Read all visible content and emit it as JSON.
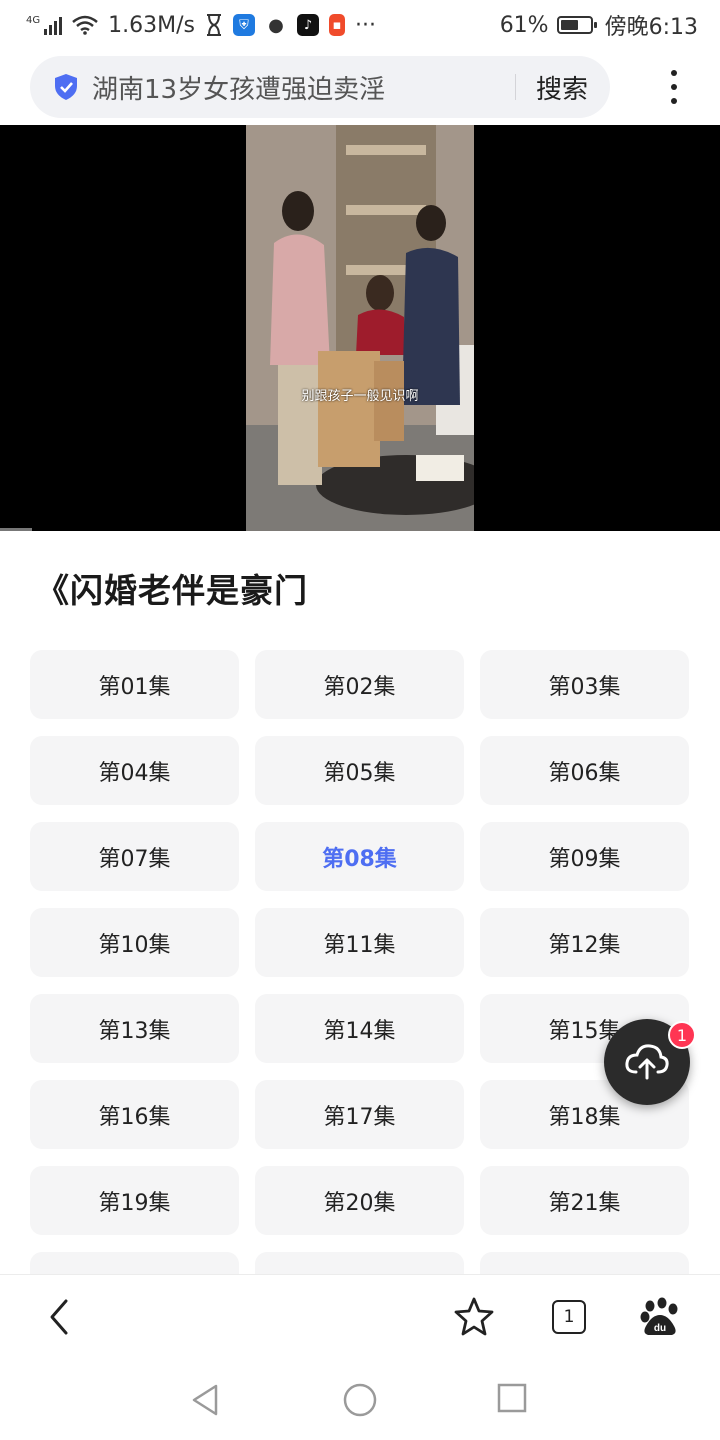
{
  "status_bar": {
    "network": "4G",
    "speed": "1.63M/s",
    "more": "···",
    "battery": "61%",
    "battery_level": 0.61,
    "time": "傍晚6:13"
  },
  "search": {
    "query": "湖南13岁女孩遭强迫卖淫",
    "button_label": "搜索"
  },
  "video": {
    "subtitle": "别跟孩子一般见识啊"
  },
  "drama": {
    "title": "《闪婚老伴是豪门"
  },
  "episodes": [
    "第01集",
    "第02集",
    "第03集",
    "第04集",
    "第05集",
    "第06集",
    "第07集",
    "第08集",
    "第09集",
    "第10集",
    "第11集",
    "第12集",
    "第13集",
    "第14集",
    "第15集",
    "第16集",
    "第17集",
    "第18集",
    "第19集",
    "第20集",
    "第21集",
    "",
    "",
    ""
  ],
  "active_episode": "第08集",
  "fab": {
    "icon": "cloud-upload-icon",
    "badge": "1"
  },
  "toolbar": {
    "tabs_count": "1"
  },
  "colors": {
    "accent": "#4e6ef2",
    "badge": "#ff3553"
  }
}
